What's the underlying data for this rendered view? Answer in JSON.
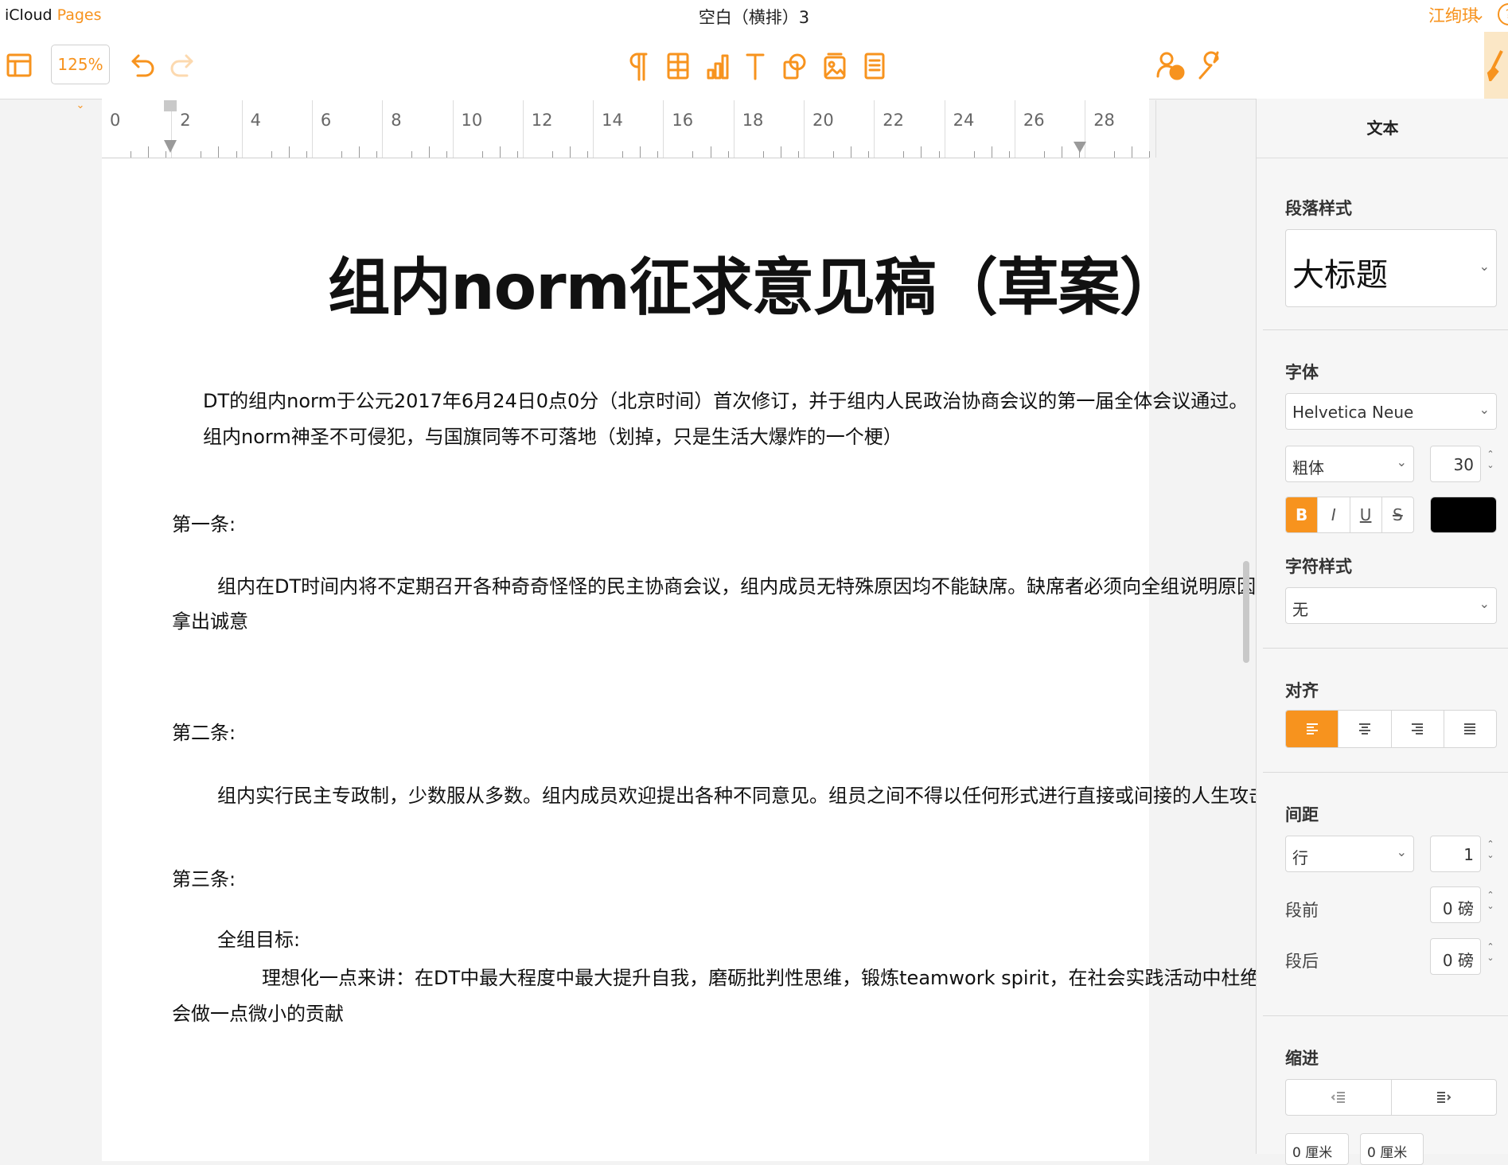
{
  "app": {
    "brand_a": "iCloud",
    "brand_b": "Pages",
    "doc_title": "空白（横排）3",
    "user": "江绚琪",
    "help": "?"
  },
  "toolbar": {
    "zoom": "125%"
  },
  "ruler": {
    "labels": [
      "0",
      "2",
      "4",
      "6",
      "8",
      "10",
      "12",
      "14",
      "16",
      "18",
      "20",
      "22",
      "24",
      "26",
      "28"
    ]
  },
  "document": {
    "heading": "组内norm征求意见稿（草案）",
    "intro1": "DT的组内norm于公元2017年6月24日0点0分（北京时间）首次修订，并于组内人民政治协商会议的第一届全体会议通过。",
    "intro2": "组内norm神圣不可侵犯，与国旗同等不可落地（划掉，只是生活大爆炸的一个梗）",
    "art1_title": "第一条:",
    "art1_line1": "组内在DT时间内将不定期召开各种奇奇怪怪的民主协商会议，组内成员无特殊原因均不能缺席。缺席者必须向全组说明原因。屡次缺席者应当",
    "art1_line2": "拿出诚意",
    "art2_title": "第二条:",
    "art2_line1": "组内实行民主专政制，少数服从多数。组内成员欢迎提出各种不同意见。组员之间不得以任何形式进行直接或间接的人生攻击。",
    "art3_title": "第三条:",
    "art3_sub": "全组目标:",
    "art3_line1": "理想化一点来讲：在DT中最大程度中最大提升自我，磨砺批判性思维，锻炼teamwork spirit，在社会实践活动中杜绝假大空，争取为社",
    "art3_line2": "会做一点微小的贡献"
  },
  "sidebar": {
    "tab": "文本",
    "para_style_label": "段落样式",
    "para_style_value": "大标题",
    "font_label": "字体",
    "font_family": "Helvetica Neue",
    "font_weight": "粗体",
    "font_size": "30",
    "bold": "B",
    "italic": "I",
    "underline": "U",
    "strike": "S",
    "text_color": "#000000",
    "char_style_label": "字符样式",
    "char_style_value": "无",
    "align_label": "对齐",
    "spacing_label": "间距",
    "spacing_mode": "行",
    "spacing_value": "1",
    "before_label": "段前",
    "before_value": "0 磅",
    "after_label": "段后",
    "after_value": "0 磅",
    "indent_label": "缩进",
    "indent_left_value": "0 厘米",
    "indent_right_value": "0 厘米"
  },
  "colors": {
    "accent": "#f7931e"
  },
  "icons": [
    "sidebar-toggle-icon",
    "undo-icon",
    "redo-icon",
    "paragraph-icon",
    "table-icon",
    "chart-icon",
    "text-icon",
    "shape-icon",
    "media-icon",
    "comment-icon",
    "collaborate-icon",
    "wrench-icon",
    "brush-icon"
  ]
}
